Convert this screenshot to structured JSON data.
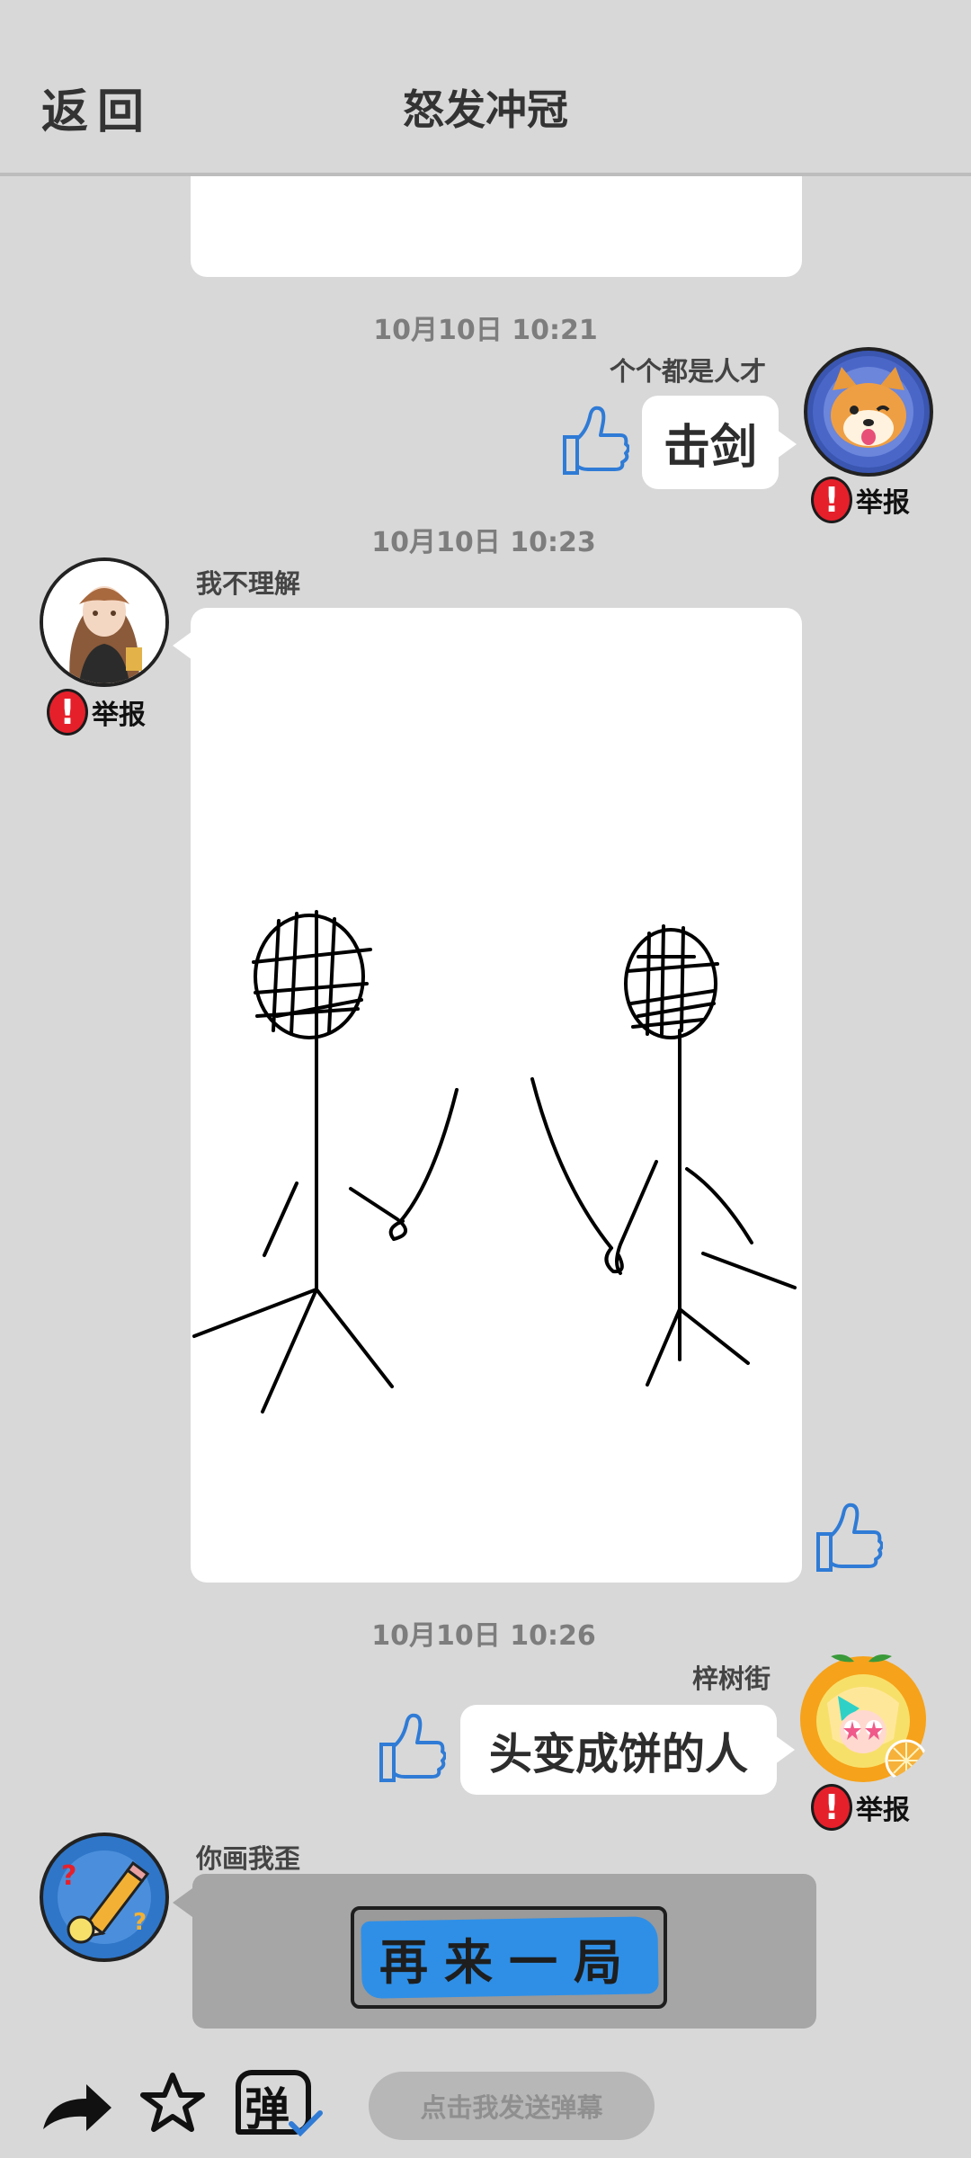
{
  "header": {
    "back_label": "返回",
    "title": "怒发冲冠",
    "back_icon": "back-text"
  },
  "messages": [
    {
      "type": "timestamp",
      "text": "10月10日  10:21"
    },
    {
      "type": "text",
      "side": "right",
      "user": "个个都是人才",
      "text": "击剑",
      "report": "举报",
      "avatar": "shiba-dog-avatar"
    },
    {
      "type": "timestamp",
      "text": "10月10日  10:23"
    },
    {
      "type": "drawing",
      "side": "left",
      "user": "我不理解",
      "report": "举报",
      "avatar": "anime-girl-avatar",
      "drawing": "two-stick-figures-fencing"
    },
    {
      "type": "timestamp",
      "text": "10月10日  10:26"
    },
    {
      "type": "text",
      "side": "right",
      "user": "梓树街",
      "text": "头变成饼的人",
      "report": "举报",
      "avatar": "orange-anime-avatar"
    },
    {
      "type": "system",
      "side": "left",
      "user": "你画我歪",
      "button_label": "再来一局",
      "avatar": "pencil-game-avatar"
    }
  ],
  "bottom_bar": {
    "share_icon": "share-arrow-icon",
    "favorite_icon": "star-icon",
    "danmaku_toggle_label": "弹",
    "danmaku_placeholder": "点击我发送弹幕"
  },
  "colors": {
    "background": "#d8d8d8",
    "report_red": "#e5202b",
    "thumb_blue": "#2f7bd6",
    "replay_blue": "#2f8fe6"
  }
}
